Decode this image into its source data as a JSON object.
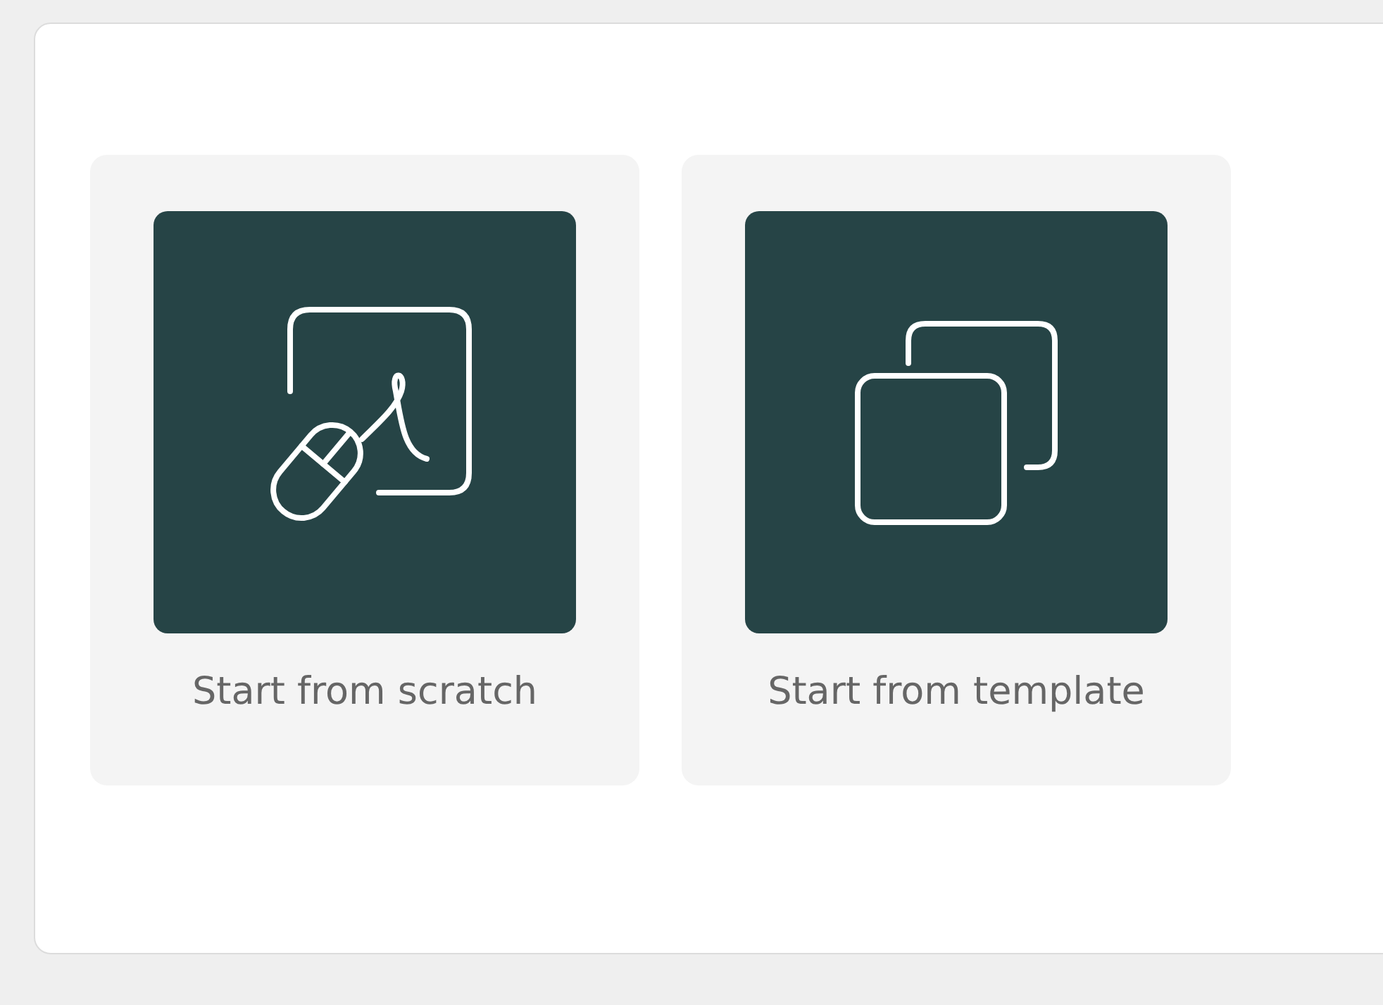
{
  "options": [
    {
      "kind": "scratch",
      "label": "Start from scratch"
    },
    {
      "kind": "template",
      "label": "Start from template"
    }
  ]
}
